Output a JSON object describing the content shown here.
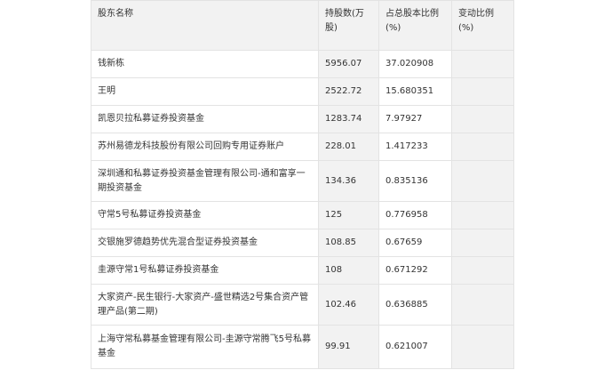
{
  "table": {
    "headers": [
      "股东名称",
      "持股数(万股)",
      "占总股本比例(%)",
      "变动比例(%)"
    ],
    "rows": [
      {
        "name": "钱新栋",
        "shares": "5956.07",
        "ratio": "37.020908",
        "change": ""
      },
      {
        "name": "王明",
        "shares": "2522.72",
        "ratio": "15.680351",
        "change": ""
      },
      {
        "name": "凯恩贝拉私募证券投资基金",
        "shares": "1283.74",
        "ratio": "7.97927",
        "change": ""
      },
      {
        "name": "苏州易德龙科技股份有限公司回购专用证券账户",
        "shares": "228.01",
        "ratio": "1.417233",
        "change": ""
      },
      {
        "name": "深圳通和私募证券投资基金管理有限公司-通和富享一期投资基金",
        "shares": "134.36",
        "ratio": "0.835136",
        "change": ""
      },
      {
        "name": "守常5号私募证券投资基金",
        "shares": "125",
        "ratio": "0.776958",
        "change": ""
      },
      {
        "name": "交银施罗德趋势优先混合型证券投资基金",
        "shares": "108.85",
        "ratio": "0.67659",
        "change": ""
      },
      {
        "name": "圭源守常1号私募证券投资基金",
        "shares": "108",
        "ratio": "0.671292",
        "change": ""
      },
      {
        "name": "大家资产-民生银行-大家资产-盛世精选2号集合资产管理产品(第二期)",
        "shares": "102.46",
        "ratio": "0.636885",
        "change": ""
      },
      {
        "name": "上海守常私募基金管理有限公司-圭源守常腾飞5号私募基金",
        "shares": "99.91",
        "ratio": "0.621007",
        "change": ""
      }
    ]
  }
}
